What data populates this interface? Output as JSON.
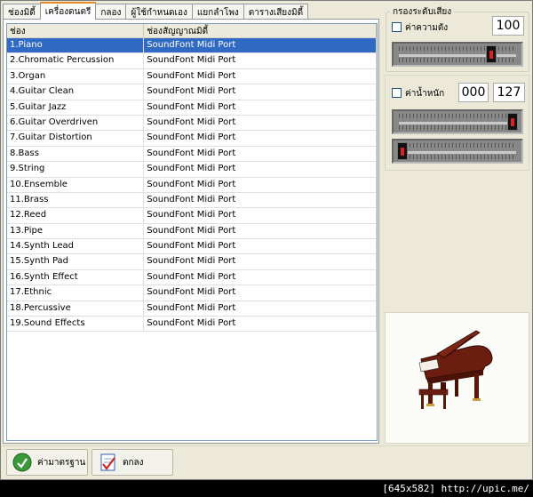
{
  "tabs": [
    {
      "label": "ช่องมิดี้"
    },
    {
      "label": "เครื่องดนตรี"
    },
    {
      "label": "กลอง"
    },
    {
      "label": "ผู้ใช้กำหนดเอง"
    },
    {
      "label": "แยกลำโพง"
    },
    {
      "label": "ตารางเสียงมิดี้"
    }
  ],
  "list": {
    "headers": {
      "channel": "ช่อง",
      "port": "ช่องสัญญาณมิดี้"
    },
    "rows": [
      {
        "name": "1.Piano",
        "port": "SoundFont Midi Port"
      },
      {
        "name": "2.Chromatic Percussion",
        "port": "SoundFont Midi Port"
      },
      {
        "name": "3.Organ",
        "port": "SoundFont Midi Port"
      },
      {
        "name": "4.Guitar Clean",
        "port": "SoundFont Midi Port"
      },
      {
        "name": "5.Guitar Jazz",
        "port": "SoundFont Midi Port"
      },
      {
        "name": "6.Guitar Overdriven",
        "port": "SoundFont Midi Port"
      },
      {
        "name": "7.Guitar Distortion",
        "port": "SoundFont Midi Port"
      },
      {
        "name": "8.Bass",
        "port": "SoundFont Midi Port"
      },
      {
        "name": "9.String",
        "port": "SoundFont Midi Port"
      },
      {
        "name": "10.Ensemble",
        "port": "SoundFont Midi Port"
      },
      {
        "name": "11.Brass",
        "port": "SoundFont Midi Port"
      },
      {
        "name": "12.Reed",
        "port": "SoundFont Midi Port"
      },
      {
        "name": "13.Pipe",
        "port": "SoundFont Midi Port"
      },
      {
        "name": "14.Synth Lead",
        "port": "SoundFont Midi Port"
      },
      {
        "name": "15.Synth Pad",
        "port": "SoundFont Midi Port"
      },
      {
        "name": "16.Synth Effect",
        "port": "SoundFont Midi Port"
      },
      {
        "name": "17.Ethnic",
        "port": "SoundFont Midi Port"
      },
      {
        "name": "18.Percussive",
        "port": "SoundFont Midi Port"
      },
      {
        "name": "19.Sound Effects",
        "port": "SoundFont Midi Port"
      }
    ]
  },
  "volume_filter": {
    "group_title": "กรองระดับเสียง",
    "strength_label": "ค่าความดัง",
    "strength_value": "100",
    "weight_label": "ค่าน้ำหนัก",
    "weight_min": "000",
    "weight_max": "127"
  },
  "buttons": {
    "default_label": "ค่ามาตรฐาน",
    "ok_label": "ตกลง"
  },
  "footer": "[645x582] http://upic.me/",
  "colors": {
    "selection": "#316ac5",
    "tab_accent": "#e68b2c"
  }
}
